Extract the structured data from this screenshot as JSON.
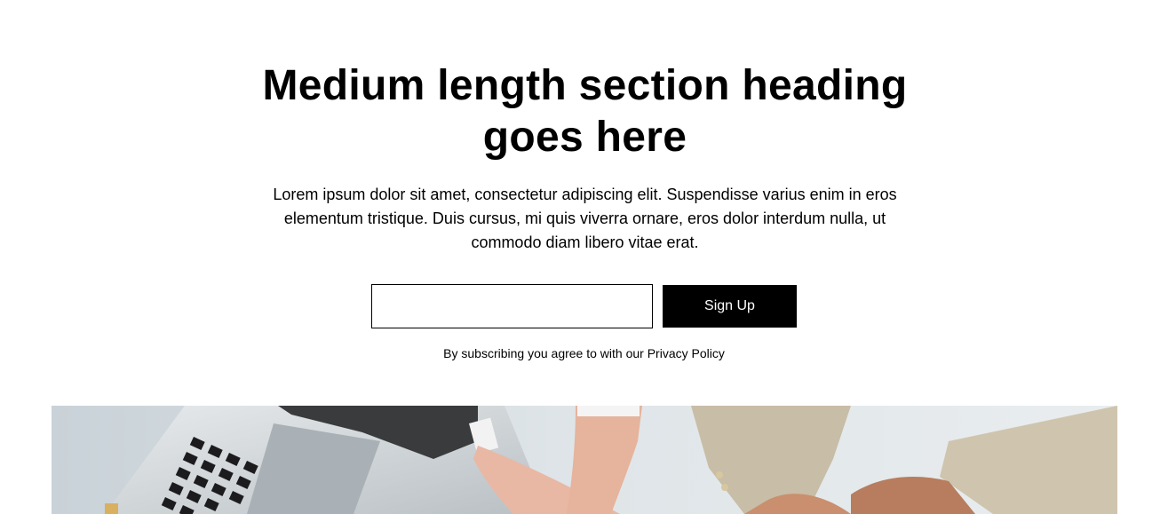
{
  "section": {
    "heading": "Medium length section heading goes here",
    "body": "Lorem ipsum dolor sit amet, consectetur adipiscing elit. Suspendisse varius enim in eros elementum tristique. Duis cursus, mi quis viverra ornare, eros dolor interdum nulla, ut commodo diam libero vitae erat.",
    "form": {
      "email_value": "",
      "email_placeholder": "",
      "submit_label": "Sign Up"
    },
    "privacy_text": "By subscribing you agree to with our Privacy Policy"
  },
  "image": {
    "subject": "business-handshake-photo",
    "alt": ""
  },
  "colors": {
    "background": "#ffffff",
    "text": "#000000",
    "button_bg": "#000000",
    "button_text": "#ffffff",
    "input_border": "#000000"
  }
}
